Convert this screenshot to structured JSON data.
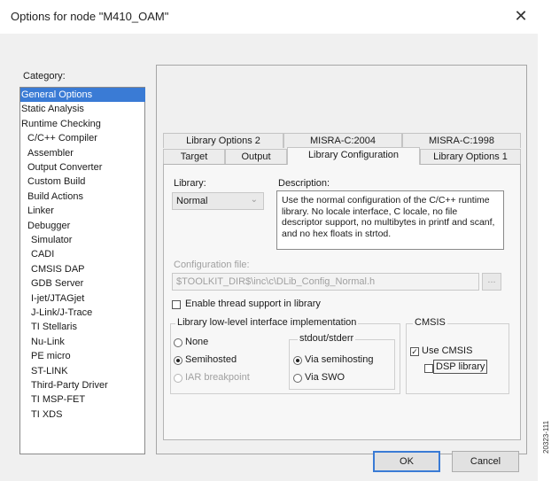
{
  "window": {
    "title": "Options for node \"M410_OAM\"",
    "close_glyph": "✕"
  },
  "category": {
    "label": "Category:",
    "selected_index": 0,
    "items": [
      {
        "label": "General Options",
        "indent": 0
      },
      {
        "label": "Static Analysis",
        "indent": 0
      },
      {
        "label": "Runtime Checking",
        "indent": 0
      },
      {
        "label": "C/C++ Compiler",
        "indent": 1
      },
      {
        "label": "Assembler",
        "indent": 1
      },
      {
        "label": "Output Converter",
        "indent": 1
      },
      {
        "label": "Custom Build",
        "indent": 1
      },
      {
        "label": "Build Actions",
        "indent": 1
      },
      {
        "label": "Linker",
        "indent": 1
      },
      {
        "label": "Debugger",
        "indent": 1
      },
      {
        "label": "Simulator",
        "indent": 2
      },
      {
        "label": "CADI",
        "indent": 2
      },
      {
        "label": "CMSIS DAP",
        "indent": 2
      },
      {
        "label": "GDB Server",
        "indent": 2
      },
      {
        "label": "I-jet/JTAGjet",
        "indent": 2
      },
      {
        "label": "J-Link/J-Trace",
        "indent": 2
      },
      {
        "label": "TI Stellaris",
        "indent": 2
      },
      {
        "label": "Nu-Link",
        "indent": 2
      },
      {
        "label": "PE micro",
        "indent": 2
      },
      {
        "label": "ST-LINK",
        "indent": 2
      },
      {
        "label": "Third-Party Driver",
        "indent": 2
      },
      {
        "label": "TI MSP-FET",
        "indent": 2
      },
      {
        "label": "TI XDS",
        "indent": 2
      }
    ]
  },
  "tabs": {
    "row_back": [
      "Library Options 2",
      "MISRA-C:2004",
      "MISRA-C:1998"
    ],
    "row_front": [
      "Target",
      "Output",
      "Library Configuration",
      "Library Options 1"
    ],
    "active": "Library Configuration"
  },
  "library": {
    "label": "Library:",
    "value": "Normal",
    "dropdown_glyph": "⌄",
    "description_label": "Description:",
    "description": "Use the normal configuration of the C/C++ runtime library. No locale interface, C locale, no file descriptor support, no multibytes in printf and scanf, and no hex floats in strtod."
  },
  "config_file": {
    "label": "Configuration file:",
    "value": "$TOOLKIT_DIR$\\inc\\c\\DLib_Config_Normal.h",
    "browse_label": "..."
  },
  "thread_support": {
    "label": "Enable thread support in library",
    "checked": false
  },
  "lowlevel": {
    "title": "Library low-level interface implementation",
    "options": [
      {
        "label": "None",
        "selected": false,
        "enabled": true
      },
      {
        "label": "Semihosted",
        "selected": true,
        "enabled": true
      },
      {
        "label": "IAR breakpoint",
        "selected": false,
        "enabled": false
      }
    ],
    "stdout": {
      "title": "stdout/stderr",
      "options": [
        {
          "label": "Via semihosting",
          "selected": true
        },
        {
          "label": "Via SWO",
          "selected": false
        }
      ]
    }
  },
  "cmsis": {
    "title": "CMSIS",
    "use_label": "Use CMSIS",
    "use_checked": true,
    "use_check_glyph": "✓",
    "dsp_label": "DSP library",
    "dsp_checked": false
  },
  "buttons": {
    "ok": "OK",
    "cancel": "Cancel"
  },
  "figure_id": "20323-111",
  "colors": {
    "selection": "#3a7bd5",
    "dialog_bg": "#f0f0f0"
  }
}
